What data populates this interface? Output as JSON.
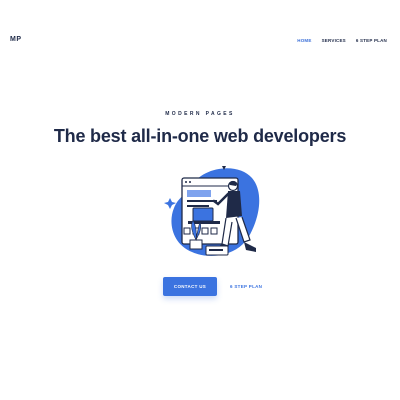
{
  "header": {
    "logo": "MP",
    "nav": [
      {
        "label": "HOME",
        "active": true
      },
      {
        "label": "SERVICES",
        "active": false
      },
      {
        "label": "6 STEP PLAN",
        "active": false
      }
    ]
  },
  "hero": {
    "eyebrow": "MODERN PAGES",
    "headline": "The best all-in-one web developers",
    "primary_button": "CONTACT US",
    "secondary_link": "6 STEP PLAN",
    "illustration": "developer-at-screen-illustration"
  },
  "colors": {
    "accent": "#3b73e0",
    "text_dark": "#1f2a48",
    "background": "#ffffff"
  }
}
